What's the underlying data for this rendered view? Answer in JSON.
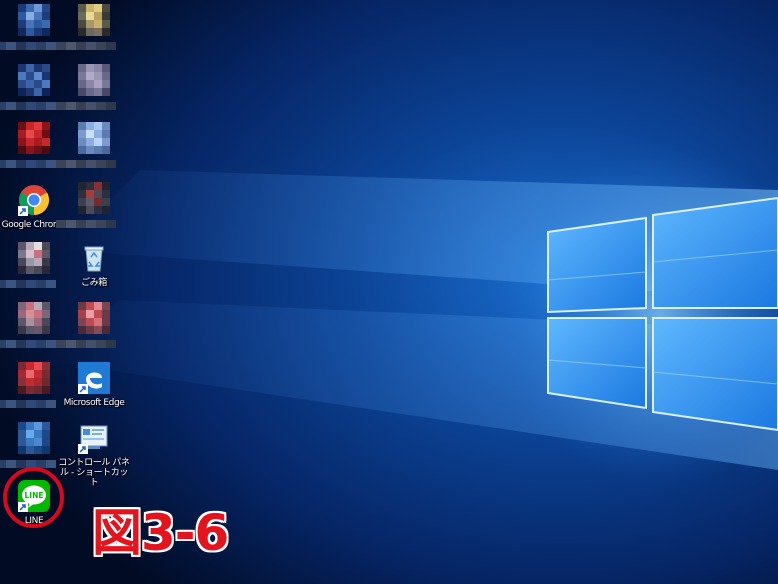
{
  "desktop": {
    "os": "Windows 10",
    "accent": "#1e7ad4",
    "icons": {
      "chrome": {
        "label": "Google Chrome",
        "icon": "chrome-icon"
      },
      "recycle_bin": {
        "label": "ごみ箱",
        "icon": "recycle-bin-icon"
      },
      "edge": {
        "label": "Microsoft Edge",
        "icon": "edge-icon"
      },
      "control_panel": {
        "label": "コントロール パネル - ショートカット",
        "icon": "control-panel-icon"
      },
      "line": {
        "label": "LINE",
        "icon": "line-icon",
        "badge_text": "LINE",
        "brand_color": "#00b900"
      }
    },
    "pixelated_icons": [
      {
        "id": "blurred-1",
        "label_hint": "",
        "color": "#4a74b8"
      },
      {
        "id": "blurred-2",
        "label_hint": "",
        "color": "#c9b36a"
      },
      {
        "id": "blurred-3",
        "label_hint": "v",
        "color": "#3a65a8"
      },
      {
        "id": "blurred-4",
        "label_hint": "",
        "color": "#8a86a8"
      },
      {
        "id": "blurred-5",
        "label_hint": "",
        "color": "#c8262a"
      },
      {
        "id": "blurred-6",
        "label_hint": "",
        "color": "#8aaee0"
      },
      {
        "id": "blurred-7",
        "label_hint": "",
        "color": "#8a3030"
      },
      {
        "id": "blurred-8",
        "label_hint": "",
        "color": "#b8a8b8"
      },
      {
        "id": "blurred-9",
        "label_hint": "",
        "color": "#c87080"
      },
      {
        "id": "blurred-10",
        "label_hint": "",
        "color": "#c04a50"
      },
      {
        "id": "blurred-11",
        "label_hint": "",
        "color": "#c62a30"
      },
      {
        "id": "blurred-12",
        "label_hint": "",
        "color": "#3a78c0"
      }
    ]
  },
  "annotation": {
    "figure_label": "図3-6",
    "highlight_color": "#d9081d"
  }
}
